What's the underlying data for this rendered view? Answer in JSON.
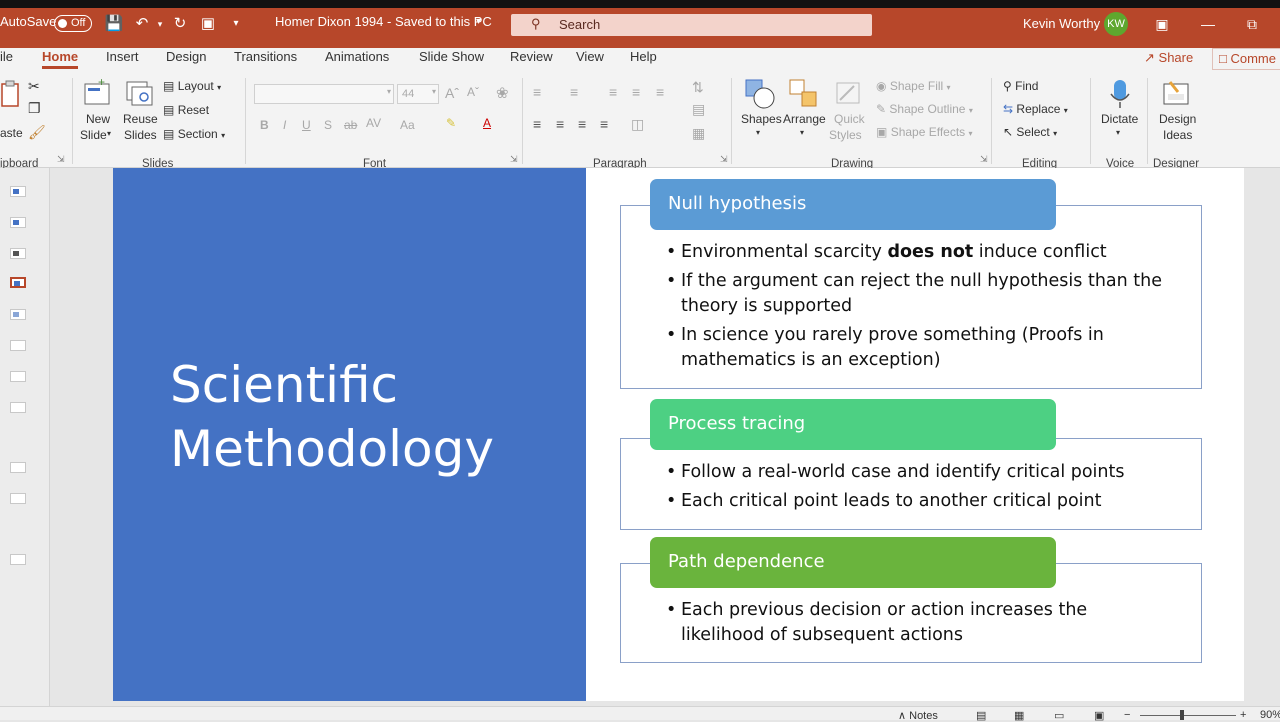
{
  "titlebar": {
    "autosave_label": "AutoSave",
    "autosave_state": "Off",
    "doc_title": "Homer Dixon 1994 - Saved to this PC",
    "search_placeholder": "Search",
    "user_name": "Kevin Worthy",
    "user_initials": "KW",
    "accent": "#b7472a"
  },
  "tabs": {
    "file": "ile",
    "home": "Home",
    "insert": "Insert",
    "design": "Design",
    "transitions": "Transitions",
    "animations": "Animations",
    "slide_show": "Slide Show",
    "review": "Review",
    "view": "View",
    "help": "Help",
    "share": "Share",
    "comments": "Comme"
  },
  "ribbon": {
    "clipboard": {
      "paste": "aste",
      "group": "ipboard"
    },
    "slides": {
      "new_slide_1": "New",
      "new_slide_2": "Slide",
      "reuse_1": "Reuse",
      "reuse_2": "Slides",
      "layout": "Layout",
      "reset": "Reset",
      "section": "Section",
      "group": "Slides"
    },
    "font": {
      "size": "44",
      "group": "Font"
    },
    "paragraph": {
      "group": "Paragraph"
    },
    "drawing": {
      "shapes": "Shapes",
      "arrange": "Arrange",
      "quick_1": "Quick",
      "quick_2": "Styles",
      "shape_fill": "Shape Fill",
      "shape_outline": "Shape Outline",
      "shape_effects": "Shape Effects",
      "group": "Drawing"
    },
    "editing": {
      "find": "Find",
      "replace": "Replace",
      "select": "Select",
      "group": "Editing"
    },
    "voice": {
      "dictate": "Dictate",
      "group": "Voice"
    },
    "designer": {
      "ideas_1": "Design",
      "ideas_2": "Ideas",
      "group": "Designer"
    }
  },
  "slide": {
    "title_line1": "Scientific",
    "title_line2": "Methodology",
    "sections": [
      {
        "heading": "Null hypothesis",
        "bullets": [
          {
            "pre": "Environmental scarcity ",
            "bold": "does not",
            "post": " induce conflict"
          },
          {
            "pre": "If the argument can reject the null hypothesis than the theory is supported",
            "bold": "",
            "post": ""
          },
          {
            "pre": "In science you rarely prove something (Proofs in mathematics is an exception)",
            "bold": "",
            "post": ""
          }
        ]
      },
      {
        "heading": "Process tracing",
        "bullets": [
          {
            "pre": "Follow a real-world case and identify critical points",
            "bold": "",
            "post": ""
          },
          {
            "pre": "Each critical point leads to another critical point",
            "bold": "",
            "post": ""
          }
        ]
      },
      {
        "heading": "Path dependence",
        "bullets": [
          {
            "pre": "Each previous decision or action increases the likelihood of subsequent actions",
            "bold": "",
            "post": ""
          }
        ]
      }
    ]
  },
  "statusbar": {
    "notes": "Notes",
    "zoom": "90%"
  }
}
